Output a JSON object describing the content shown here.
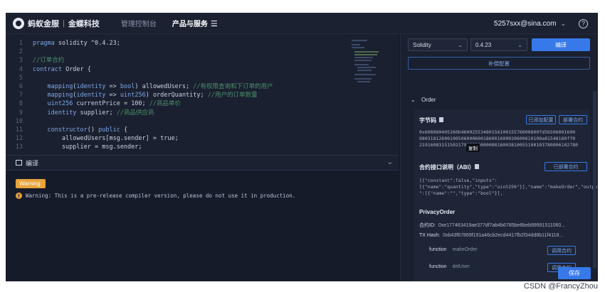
{
  "topbar": {
    "brand": "蚂蚁金服",
    "brand_partner": "金蝶科技",
    "nav": [
      {
        "label": "管理控制台",
        "active": false
      },
      {
        "label": "产品与服务",
        "active": true
      }
    ],
    "user_email": "5257sxx@sina.com"
  },
  "editor": {
    "lines": [
      {
        "num": "1",
        "text": "pragma solidity ^0.4.23;"
      },
      {
        "num": "2",
        "text": ""
      },
      {
        "num": "3",
        "text": "//订单合约"
      },
      {
        "num": "4",
        "text": "contract Order {"
      },
      {
        "num": "5",
        "text": ""
      },
      {
        "num": "6",
        "text": "    mapping(identity => bool) allowedUsers; //有权限查询和下订单的用户"
      },
      {
        "num": "7",
        "text": "    mapping(identity => uint256) orderQuantity; //用户的订单数量"
      },
      {
        "num": "8",
        "text": "    uint256 currentPrice = 100; //商品单价"
      },
      {
        "num": "9",
        "text": "    identity supplier; //商品供应商"
      },
      {
        "num": "10",
        "text": ""
      },
      {
        "num": "11",
        "text": "    constructor() public {"
      },
      {
        "num": "12",
        "text": "        allowedUsers[msg.sender] = true;"
      },
      {
        "num": "13",
        "text": "        supplier = msg.sender;"
      }
    ]
  },
  "output": {
    "title": "编译",
    "badge": "Warning:",
    "message": "Warning: This is a pre-release compiler version, please do not use it in production."
  },
  "panel": {
    "language": "Solidity",
    "version": "0.4.23",
    "compile_label": "编译",
    "advanced_label": "补偿配置",
    "contract_name": "Order",
    "bytecode_label": "字节码",
    "copy_bytecode_label": "已添加配置",
    "deploy_label": "部署合约",
    "bytecode_text": "0x608060405260b4600255348015610015576000800fd5b506001600\n08031812600190506000600186001600020600610100a81548160ff0\n219160831515021790555600008016003810055100103780806102780",
    "tooltip": "复制",
    "abi_label": "合约接口说明（ABI）",
    "abi_deploy_label": "已部署合约",
    "abi_text": "[{\"constant\":false,\"inputs\":\n[{\"name\":\"quantity\",\"type\":\"uint256\"}],\"name\":\"makeOrder\",\"outputs\n\":[{\"name\":\"\",\"type\":\"bool\"}],",
    "section_title": "PrivacyOrder",
    "address_label": "合约ID:",
    "address_value": "0xe177463419ae377df7ab4b6785be8beb99991511060...",
    "txhash_label": "TX Hash:",
    "txhash_value": "0xb43f67869f191a46cb2ecd4417fb2f34dd8b11f4118...",
    "functions": [
      {
        "kw": "function",
        "name": "makeOrder",
        "action": "调用合约"
      },
      {
        "kw": "function",
        "name": "delUser",
        "action": "调用合约"
      }
    ],
    "save_label": "保存"
  },
  "watermark": "CSDN @FrancyZhou"
}
